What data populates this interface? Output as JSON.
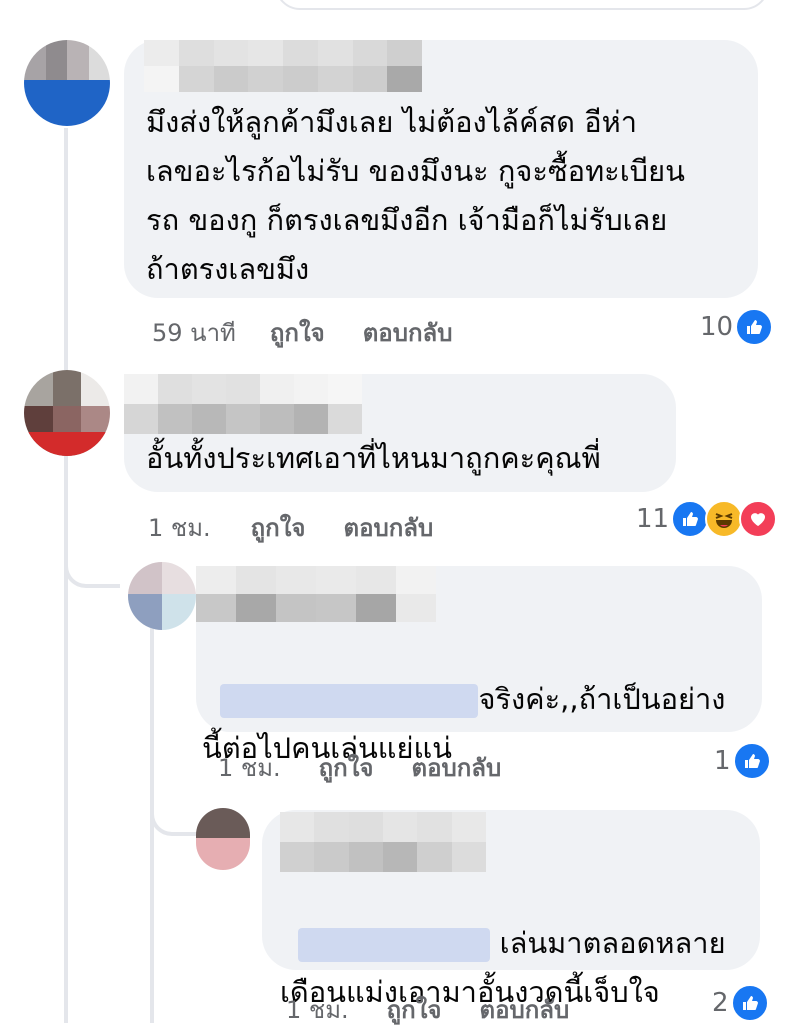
{
  "comments": [
    {
      "text": "มึงส่งให้ลูกค้ามึงเลย ไม่ต้องไล้ค์สด อีห่า\nเลขอะไรก้อไม่รับ ของมึงนะ กูจะซื้อทะเบียน\nรถ ของกู ก็ตรงเลขมึงอีก เจ้ามือก็ไม่รับเลย\nถ้าตรงเลขมึง",
      "time": "59 นาที",
      "like_label": "ถูกใจ",
      "reply_label": "ตอบกลับ",
      "reaction_count": "10",
      "reactions": [
        "like-icon"
      ]
    },
    {
      "text": "อั้นทั้งประเทศเอาที่ไหนมาถูกคะคุณพี่",
      "time": "1 ชม.",
      "like_label": "ถูกใจ",
      "reply_label": "ตอบกลับ",
      "reaction_count": "11",
      "reactions": [
        "like-icon",
        "haha-icon",
        "love-icon"
      ]
    },
    {
      "text_line1": "จริงค่ะ,,ถ้าเป็นอย่าง",
      "text_line2": "นี้ต่อไปคนเล่นแย่แน่",
      "time": "1 ชม.",
      "like_label": "ถูกใจ",
      "reply_label": "ตอบกลับ",
      "reaction_count": "1",
      "reactions": [
        "like-icon"
      ]
    },
    {
      "text_line1": "เล่นมาตลอดหลาย",
      "text_line2": "เดือนแม่งเอามาอั้นงวดนี้เจ็บใจ",
      "time": "1 ชม.",
      "like_label": "ถูกใจ",
      "reply_label": "ตอบกลับ",
      "reaction_count": "2",
      "reactions": [
        "like-icon"
      ]
    }
  ],
  "colors": {
    "bubble": "#f0f2f5",
    "like": "#1877f2",
    "haha": "#f7b928",
    "love": "#f33e58",
    "meta": "#65676b"
  }
}
